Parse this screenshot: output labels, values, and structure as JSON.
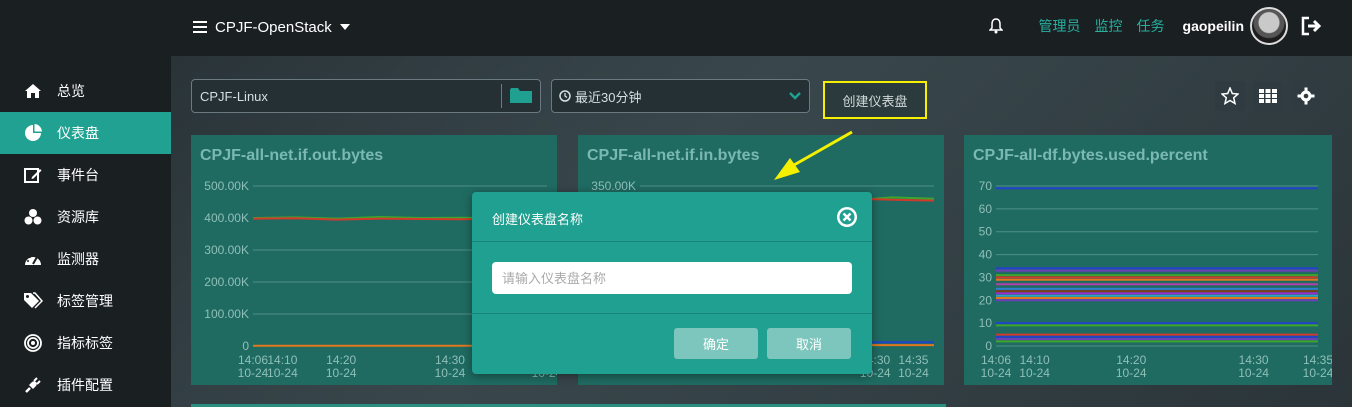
{
  "topbar": {
    "project": "CPJF-OpenStack",
    "links": [
      "管理员",
      "监控",
      "任务"
    ],
    "username": "gaopeilin"
  },
  "sidebar": {
    "items": [
      {
        "label": "总览",
        "icon": "home-icon"
      },
      {
        "label": "仪表盘",
        "icon": "pie-chart-icon",
        "active": true
      },
      {
        "label": "事件台",
        "icon": "edit-icon"
      },
      {
        "label": "资源库",
        "icon": "cubes-icon"
      },
      {
        "label": "监测器",
        "icon": "dashboard-icon"
      },
      {
        "label": "标签管理",
        "icon": "tags-icon"
      },
      {
        "label": "指标标签",
        "icon": "target-icon"
      },
      {
        "label": "插件配置",
        "icon": "plug-icon"
      }
    ]
  },
  "toolbar": {
    "dashboard_value": "CPJF-Linux",
    "time_range": "最近30分钟",
    "create_label": "创建仪表盘"
  },
  "panels": [
    {
      "title": "CPJF-all-net.if.out.bytes"
    },
    {
      "title": "CPJF-all-net.if.in.bytes"
    },
    {
      "title": "CPJF-all-df.bytes.used.percent"
    }
  ],
  "chart_data": [
    {
      "type": "line",
      "title": "CPJF-all-net.if.out.bytes",
      "ylim": [
        0,
        500000
      ],
      "y_ticks": [
        "500.00K",
        "400.00K",
        "300.00K",
        "200.00K",
        "100.00K",
        "0"
      ],
      "x_ticks": [
        [
          "14:06",
          "10-24"
        ],
        [
          "14:10",
          "10-24"
        ],
        [
          "14:20",
          "10-24"
        ],
        [
          "14:30",
          "10-24"
        ],
        [
          "14:35",
          "10-24"
        ]
      ],
      "x": [
        "14:06",
        "14:10",
        "14:14",
        "14:18",
        "14:22",
        "14:26",
        "14:30",
        "14:35"
      ],
      "series": [
        {
          "color": "#3ea52c",
          "values": [
            400000,
            402000,
            398000,
            403000,
            400000,
            401000,
            399000,
            400000
          ]
        },
        {
          "color": "#d0392b",
          "values": [
            398000,
            399000,
            395000,
            398000,
            397000,
            396000,
            398000,
            397000
          ]
        },
        {
          "color": "#e0791e",
          "values": [
            1000,
            1000,
            1000,
            1000,
            1000,
            1000,
            1000,
            1000
          ]
        }
      ]
    },
    {
      "type": "line",
      "title": "CPJF-all-net.if.in.bytes",
      "ylim": [
        0,
        350000
      ],
      "y_ticks": [
        "350.00K"
      ],
      "x_ticks": [
        [
          "14:30",
          "10-24"
        ],
        [
          "14:35",
          "10-24"
        ]
      ],
      "x": [
        "14:06",
        "14:10",
        "14:14",
        "14:18",
        "14:22",
        "14:26",
        "14:30",
        "14:35"
      ],
      "series": [
        {
          "color": "#3ea52c",
          "values": [
            330000,
            331000,
            329000,
            332000,
            330000,
            318000,
            325000,
            322000
          ]
        },
        {
          "color": "#d0392b",
          "values": [
            325000,
            326000,
            324000,
            327000,
            325000,
            322000,
            320000,
            318000
          ]
        },
        {
          "color": "#2243c9",
          "values": [
            8000,
            8000,
            8000,
            8000,
            8000,
            8000,
            8000,
            8000
          ]
        },
        {
          "color": "#e0791e",
          "values": [
            2000,
            2000,
            2000,
            2000,
            2000,
            2000,
            2000,
            2000
          ]
        }
      ]
    },
    {
      "type": "line",
      "title": "CPJF-all-df.bytes.used.percent",
      "ylim": [
        0,
        70
      ],
      "y_ticks": [
        "70",
        "60",
        "50",
        "40",
        "30",
        "20",
        "10",
        "0"
      ],
      "x_ticks": [
        [
          "14:06",
          "10-24"
        ],
        [
          "14:10",
          "10-24"
        ],
        [
          "14:20",
          "10-24"
        ],
        [
          "14:30",
          "10-24"
        ],
        [
          "14:35",
          "10-24"
        ]
      ],
      "x": [
        "14:06",
        "14:35"
      ],
      "series": [
        {
          "color": "#2243c9",
          "values": [
            69,
            69
          ]
        },
        {
          "color": "#2243c9",
          "values": [
            34,
            34
          ]
        },
        {
          "color": "#6e3fb8",
          "values": [
            33,
            33
          ]
        },
        {
          "color": "#3ea52c",
          "values": [
            31,
            31
          ]
        },
        {
          "color": "#d0392b",
          "values": [
            30,
            30
          ]
        },
        {
          "color": "#e0791e",
          "values": [
            29,
            29
          ]
        },
        {
          "color": "#b33fa8",
          "values": [
            27,
            27
          ]
        },
        {
          "color": "#2e7fcf",
          "values": [
            25,
            25
          ]
        },
        {
          "color": "#7a3e18",
          "values": [
            24,
            24
          ]
        },
        {
          "color": "#9b2bd0",
          "values": [
            23,
            23
          ]
        },
        {
          "color": "#2fa4bf",
          "values": [
            22,
            22
          ]
        },
        {
          "color": "#e0791e",
          "values": [
            21,
            21
          ]
        },
        {
          "color": "#6e3fb8",
          "values": [
            20,
            20
          ]
        },
        {
          "color": "#2243c9",
          "values": [
            10,
            10
          ]
        },
        {
          "color": "#3ea52c",
          "values": [
            9,
            9
          ]
        },
        {
          "color": "#d0392b",
          "values": [
            5,
            5
          ]
        },
        {
          "color": "#2243c9",
          "values": [
            4,
            4
          ]
        },
        {
          "color": "#6e3fb8",
          "values": [
            3,
            3
          ]
        },
        {
          "color": "#3ea52c",
          "values": [
            2,
            2
          ]
        }
      ]
    }
  ],
  "modal": {
    "title": "创建仪表盘名称",
    "placeholder": "请输入仪表盘名称",
    "confirm": "确定",
    "cancel": "取消"
  },
  "colors": {
    "accent": "#1fa090",
    "highlight": "#f5f000",
    "panel": "#1f6b62"
  }
}
